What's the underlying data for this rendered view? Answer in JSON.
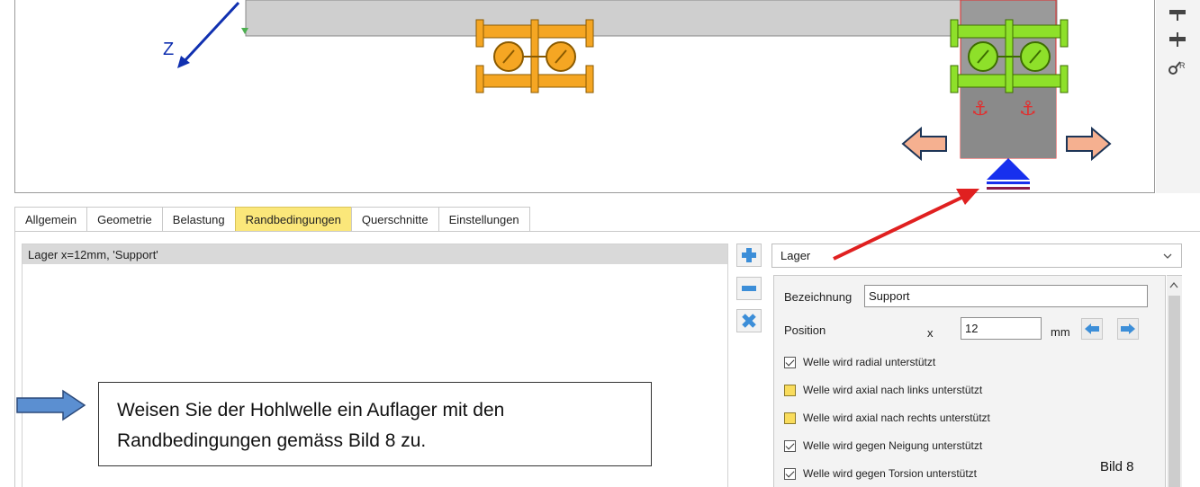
{
  "viewport": {
    "axis_label": "Z"
  },
  "toolbar_icons": [
    "support-top-icon",
    "support-mid-icon",
    "moment-r-icon"
  ],
  "tabs": [
    {
      "label": "Allgemein"
    },
    {
      "label": "Geometrie"
    },
    {
      "label": "Belastung"
    },
    {
      "label": "Randbedingungen"
    },
    {
      "label": "Querschnitte"
    },
    {
      "label": "Einstellungen"
    }
  ],
  "active_tab": "Randbedingungen",
  "list": {
    "items": [
      "Lager x=12mm, 'Support'"
    ]
  },
  "type_select": {
    "value": "Lager"
  },
  "props": {
    "bezeichnung_label": "Bezeichnung",
    "bezeichnung_value": "Support",
    "position_label": "Position",
    "axis": "x",
    "position_value": "12",
    "unit": "mm",
    "checks": [
      {
        "label": "Welle wird radial unterstützt",
        "state": "checked"
      },
      {
        "label": "Welle wird axial nach links unterstützt",
        "state": "yellow"
      },
      {
        "label": "Welle wird axial nach rechts unterstützt",
        "state": "yellow"
      },
      {
        "label": "Welle wird gegen Neigung unterstützt",
        "state": "checked"
      },
      {
        "label": "Welle wird gegen Torsion unterstützt",
        "state": "checked"
      }
    ]
  },
  "callout": {
    "line1": "Weisen Sie der Hohlwelle ein Auflager mit den",
    "line2": "Randbedingungen gemäss Bild 8 zu."
  },
  "figure_label": "Bild 8",
  "colors": {
    "active_tab": "#fbe77a",
    "bearing_orange": "#f5a623",
    "bearing_green": "#8ee02a",
    "annotation_red": "#e02020",
    "arrow_blue": "#5b8fd1",
    "axis_blue": "#1030b0"
  }
}
